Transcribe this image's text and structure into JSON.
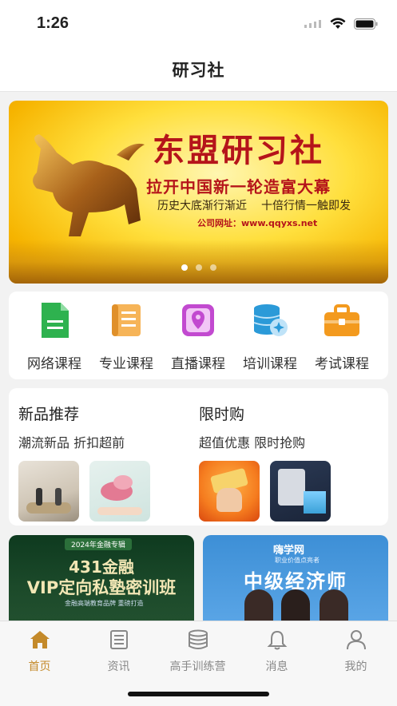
{
  "status": {
    "time": "1:26"
  },
  "nav": {
    "title": "研习社"
  },
  "banner": {
    "title": "东盟研习社",
    "subtitle": "拉开中国新一轮造富大幕",
    "tagline_left": "历史大底渐行渐近",
    "tagline_right": "十倍行情一触即发",
    "url": "公司网址：www.qqyxs.net",
    "page_count": 3,
    "active_page": 1
  },
  "categories": [
    {
      "label": "网络课程",
      "icon": "document-icon",
      "color": "#2eb24f"
    },
    {
      "label": "专业课程",
      "icon": "scroll-icon",
      "color": "#f2a23a"
    },
    {
      "label": "直播课程",
      "icon": "location-pin-icon",
      "color": "#c24ad0"
    },
    {
      "label": "培训课程",
      "icon": "database-icon",
      "color": "#2b9ad8"
    },
    {
      "label": "考试课程",
      "icon": "briefcase-icon",
      "color": "#f39a1e"
    }
  ],
  "promo": {
    "new": {
      "title": "新品推荐",
      "subtitle": "潮流新品 折扣超前"
    },
    "limited": {
      "title": "限时购",
      "subtitle": "超值优惠 限时抢购"
    }
  },
  "ads": {
    "left": {
      "brand": "",
      "tag": "2024年金融专辑",
      "line1": "431金融",
      "line2": "VIP定向私塾密训班",
      "line3": "金融高端教育品牌 重磅打造"
    },
    "right": {
      "logo": "嗨学网",
      "sub": "职业价值点亮者",
      "title": "中级经济师"
    }
  },
  "tabs": [
    {
      "label": "首页",
      "icon": "home-icon",
      "active": true
    },
    {
      "label": "资讯",
      "icon": "news-icon",
      "active": false
    },
    {
      "label": "高手训练营",
      "icon": "coins-icon",
      "active": false
    },
    {
      "label": "消息",
      "icon": "bell-icon",
      "active": false
    },
    {
      "label": "我的",
      "icon": "user-icon",
      "active": false
    }
  ],
  "colors": {
    "accent": "#c48a2a",
    "banner_red": "#b5141a"
  }
}
